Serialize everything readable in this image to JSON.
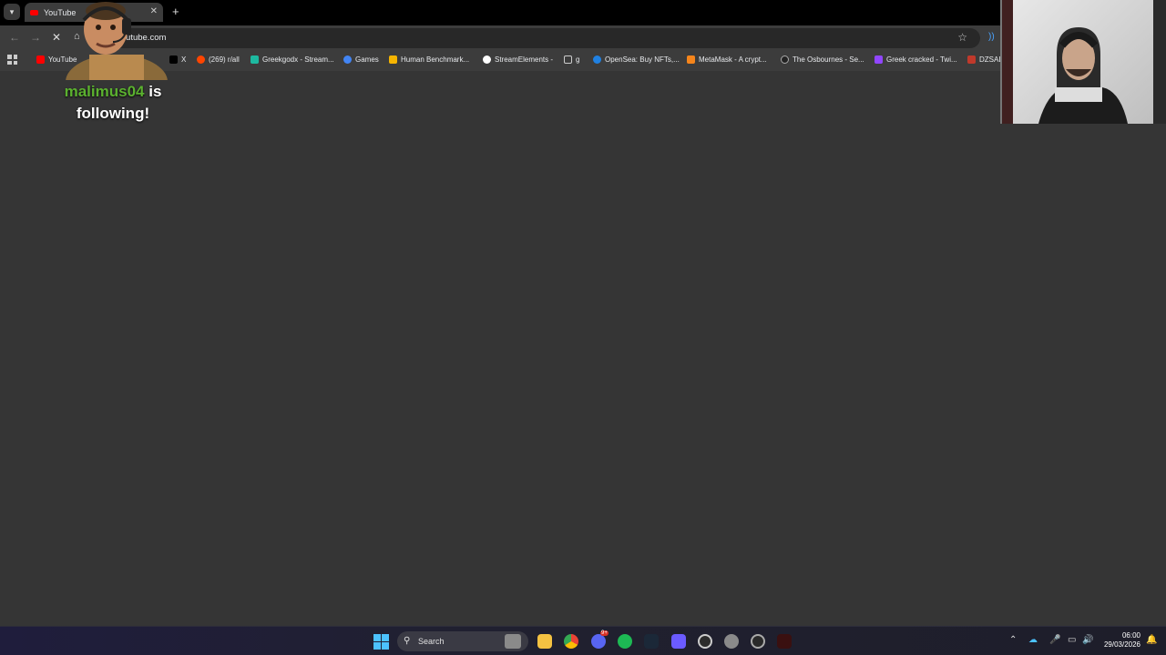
{
  "browser": {
    "tab": {
      "title": "YouTube"
    },
    "url": "youtube.com",
    "bookmarks": [
      {
        "label": "YouTube",
        "color": "#ff0000"
      },
      {
        "label": "X",
        "color": "#000000"
      },
      {
        "label": "(269) r/all",
        "color": "#ff4500"
      },
      {
        "label": "Greekgodx - Stream...",
        "color": "#1db9a0"
      },
      {
        "label": "Games",
        "color": "#4285f4"
      },
      {
        "label": "Human Benchmark...",
        "color": "#f5b400"
      },
      {
        "label": "StreamElements -",
        "color": "#ffffff"
      },
      {
        "label": "g",
        "color": "#3c3c3c"
      },
      {
        "label": "OpenSea: Buy NFTs,...",
        "color": "#2081e2"
      },
      {
        "label": "MetaMask - A crypt...",
        "color": "#f6851b"
      },
      {
        "label": "The Osbournes - Se...",
        "color": "#222222"
      },
      {
        "label": "Greek cracked - Twi...",
        "color": "#9146ff"
      },
      {
        "label": "DZSAL",
        "color": "#c0392b"
      }
    ]
  },
  "overlay": {
    "follower": "malimus04",
    "message_1": "is",
    "message_2": "following!"
  },
  "taskbar": {
    "search_label": "Search",
    "time": "06:00",
    "date": "29/03/2026",
    "discord_badge": "9+"
  },
  "colors": {
    "follower_name": "#5bb12f",
    "accent": "#4cc2ff"
  }
}
